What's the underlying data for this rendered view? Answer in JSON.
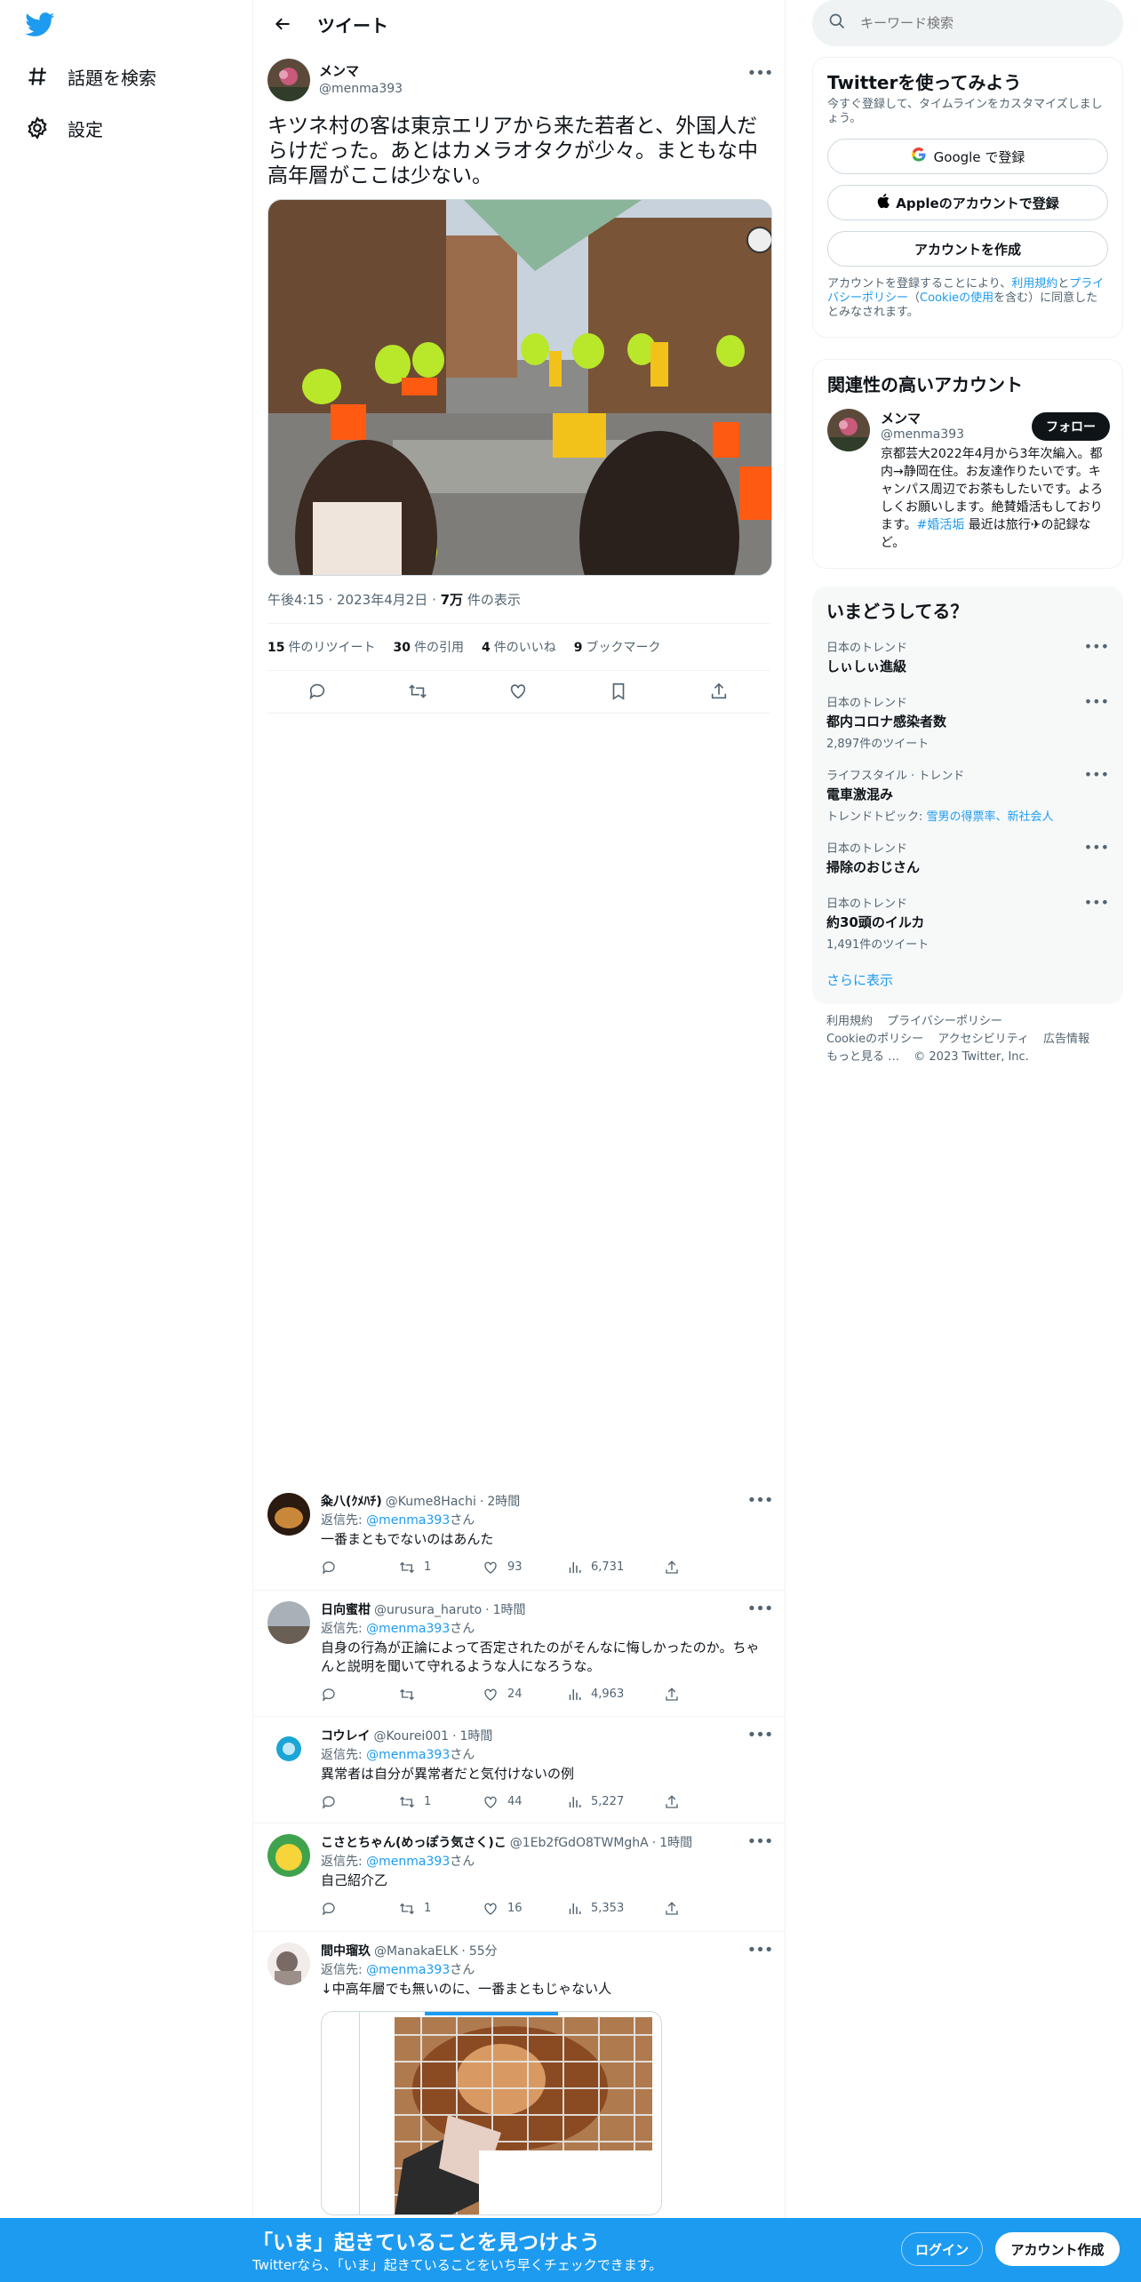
{
  "nav": {
    "explore_label": "話題を検索",
    "settings_label": "設定"
  },
  "header": {
    "title": "ツイート"
  },
  "tweet": {
    "author_name": "メンマ",
    "author_handle": "@menma393",
    "text": "キツネ村の客は東京エリアから来た若者と、外国人だらけだった。あとはカメラオタクが少々。まともな中高年層がここは少ない。",
    "time": "午後4:15",
    "date": "2023年4月2日",
    "views_num": "7万",
    "views_label": "件の表示",
    "retweets_num": "15",
    "retweets_label": "件のリツイート",
    "quotes_num": "30",
    "quotes_label": "件の引用",
    "likes_num": "4",
    "likes_label": "件のいいね",
    "bookmarks_num": "9",
    "bookmarks_label": "ブックマーク"
  },
  "replies": [
    {
      "name": "粂八(ｸﾒﾊﾁ)",
      "handle": "@Kume8Hachi",
      "time": "2時間",
      "replying_prefix": "返信先:",
      "replying_to": "@menma393",
      "replying_suffix": "さん",
      "text": "一番まともでないのはあんた",
      "retweets": "1",
      "likes": "93",
      "views": "6,731"
    },
    {
      "name": "日向蜜柑",
      "handle": "@urusura_haruto",
      "time": "1時間",
      "replying_prefix": "返信先:",
      "replying_to": "@menma393",
      "replying_suffix": "さん",
      "text": "自身の行為が正論によって否定されたのがそんなに悔しかったのか。ちゃんと説明を聞いて守れるような人になろうな。",
      "retweets": "",
      "likes": "24",
      "views": "4,963"
    },
    {
      "name": "コウレイ",
      "handle": "@Kourei001",
      "time": "1時間",
      "replying_prefix": "返信先:",
      "replying_to": "@menma393",
      "replying_suffix": "さん",
      "text": "異常者は自分が異常者だと気付けないの例",
      "retweets": "1",
      "likes": "44",
      "views": "5,227"
    },
    {
      "name": "こさとちゃん(めっぽう気さく)こ",
      "handle": "@1Eb2fGdO8TWMghA",
      "time": "1時間",
      "replying_prefix": "返信先:",
      "replying_to": "@menma393",
      "replying_suffix": "さん",
      "text": "自己紹介乙",
      "retweets": "1",
      "likes": "16",
      "views": "5,353"
    },
    {
      "name": "間中瑠玖",
      "handle": "@ManakaELK",
      "time": "55分",
      "replying_prefix": "返信先:",
      "replying_to": "@menma393",
      "replying_suffix": "さん",
      "text": "↓中高年層でも無いのに、一番まともじゃない人"
    }
  ],
  "search": {
    "placeholder": "キーワード検索"
  },
  "signup_card": {
    "title": "Twitterを使ってみよう",
    "subtitle": "今すぐ登録して、タイムラインをカスタマイズしましょう。",
    "google_label": "Google で登録",
    "apple_label": "Appleのアカウントで登録",
    "create_label": "アカウントを作成",
    "terms_prefix": "アカウントを登録することにより、",
    "terms_link": "利用規約",
    "terms_and": "と",
    "privacy_link": "プライバシーポリシー",
    "cookie_open": "（",
    "cookie_link": "Cookieの使用",
    "terms_suffix": "を含む）に同意したとみなされます。"
  },
  "related_card": {
    "title": "関連性の高いアカウント",
    "name": "メンマ",
    "handle": "@menma393",
    "follow_label": "フォロー",
    "bio": "京都芸大2022年4月から3年次編入。都内→静岡在住。お友達作りたいです。キャンパス周辺でお茶もしたいです。よろしくお願いします。絶賛婚活もしております。",
    "bio_hashtag": "#婚活垢",
    "bio_tail": " 最近は旅行",
    "bio_tail2": "の記録など。"
  },
  "trends_card": {
    "title": "いまどうしてる？",
    "items": [
      {
        "category": "日本のトレンド",
        "name": "しぃしぃ進級",
        "count": ""
      },
      {
        "category": "日本のトレンド",
        "name": "都内コロナ感染者数",
        "count": "2,897件のツイート"
      },
      {
        "category": "ライフスタイル · トレンド",
        "name": "電車激混み",
        "count_prefix": "トレンドトピック: ",
        "count_links": "雪男の得票率、新社会人"
      },
      {
        "category": "日本のトレンド",
        "name": "掃除のおじさん",
        "count": ""
      },
      {
        "category": "日本のトレンド",
        "name": "約30頭のイルカ",
        "count": "1,491件のツイート"
      }
    ],
    "show_more": "さらに表示"
  },
  "footer": {
    "terms": "利用規約",
    "privacy": "プライバシーポリシー",
    "cookie": "Cookieのポリシー",
    "accessibility": "アクセシビリティ",
    "ads": "広告情報",
    "more": "もっと見る …",
    "copyright": "© 2023 Twitter, Inc."
  },
  "bottom_bar": {
    "title": "「いま」起きていることを見つけよう",
    "subtitle": "Twitterなら、「いま」起きていることをいち早くチェックできます。",
    "login": "ログイン",
    "signup": "アカウント作成"
  },
  "colors": {
    "accent": "#1d9bf0",
    "text": "#0f1419",
    "muted": "#536471"
  }
}
